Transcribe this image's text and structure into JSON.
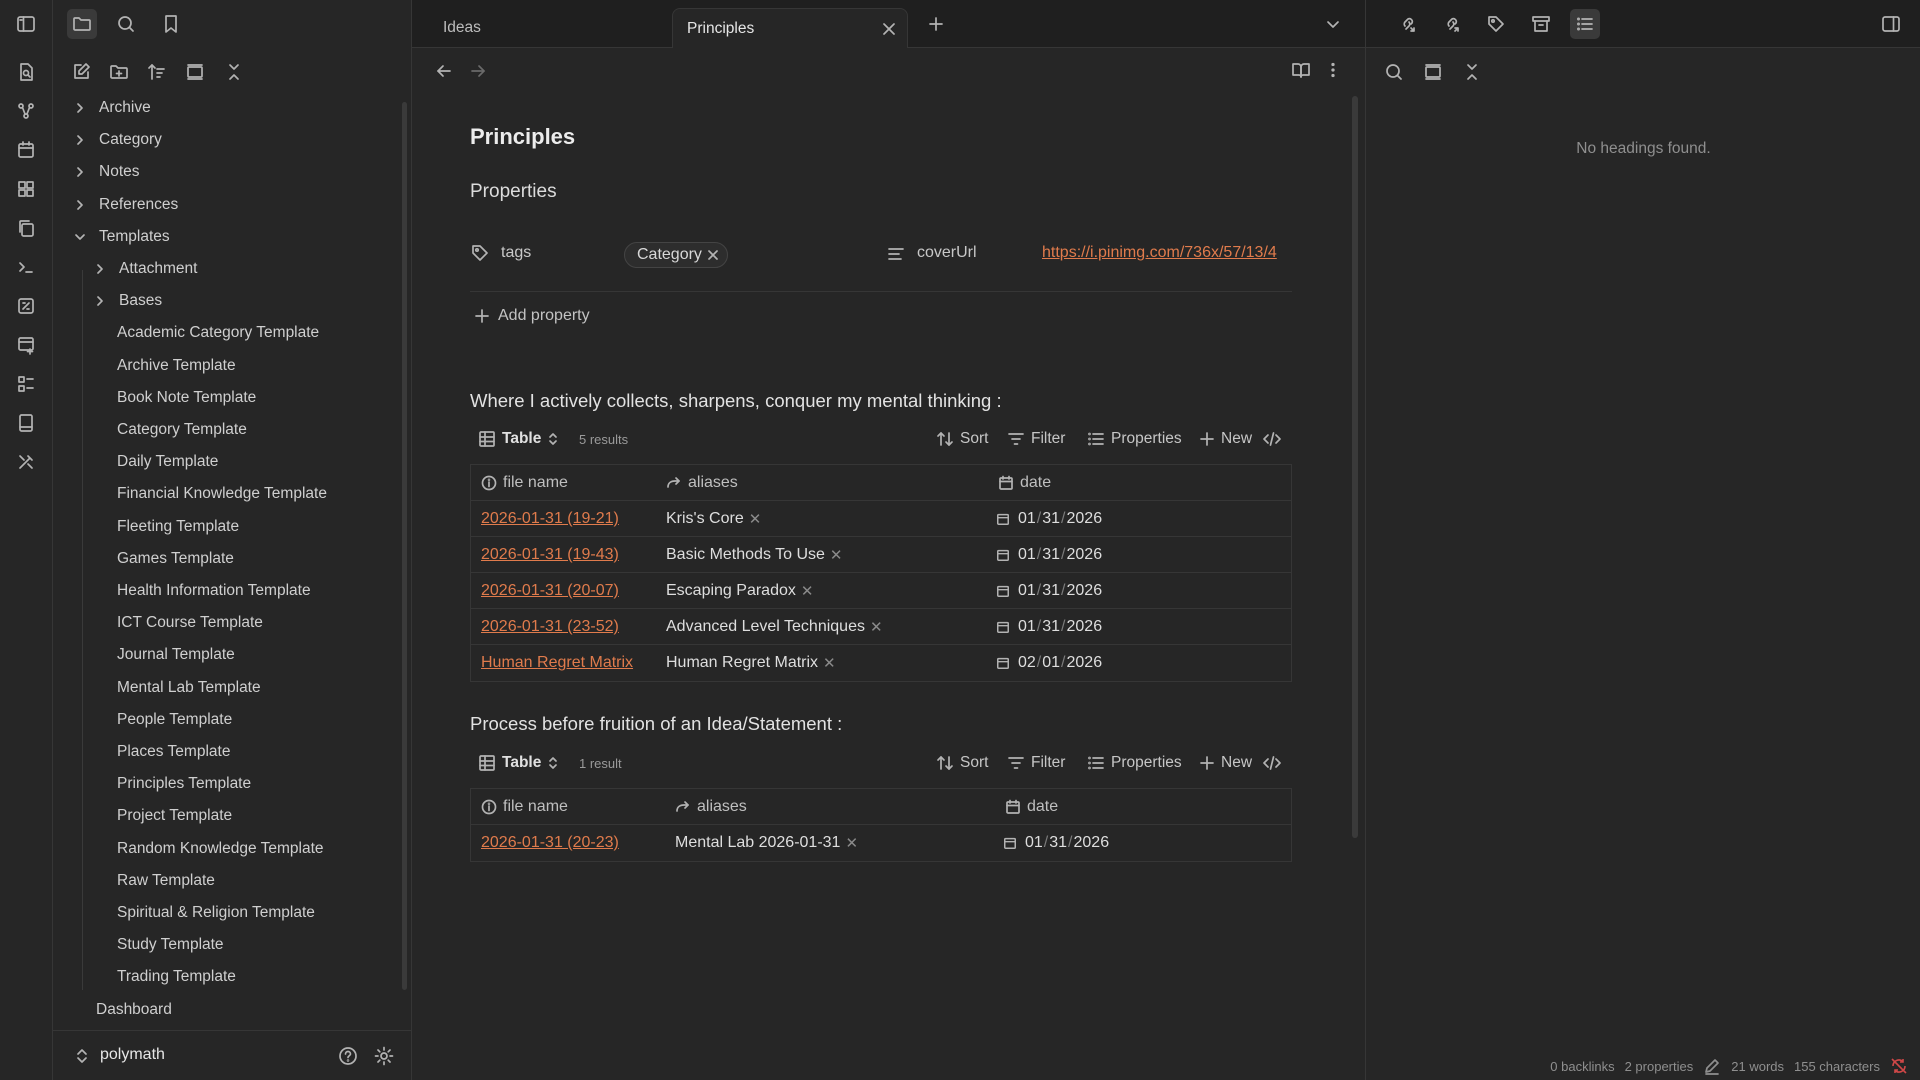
{
  "tabs": [
    {
      "label": "Ideas",
      "active": false
    },
    {
      "label": "Principles",
      "active": true
    }
  ],
  "sidebar": {
    "tree": [
      {
        "label": "Archive",
        "type": "folder",
        "expanded": false,
        "depth": 0
      },
      {
        "label": "Category",
        "type": "folder",
        "expanded": false,
        "depth": 0
      },
      {
        "label": "Notes",
        "type": "folder",
        "expanded": false,
        "depth": 0
      },
      {
        "label": "References",
        "type": "folder",
        "expanded": false,
        "depth": 0
      },
      {
        "label": "Templates",
        "type": "folder",
        "expanded": true,
        "depth": 0
      },
      {
        "label": "Attachment",
        "type": "folder",
        "expanded": false,
        "depth": 1
      },
      {
        "label": "Bases",
        "type": "folder",
        "expanded": false,
        "depth": 1
      },
      {
        "label": "Academic Category Template",
        "type": "file",
        "depth": 1
      },
      {
        "label": "Archive Template",
        "type": "file",
        "depth": 1
      },
      {
        "label": "Book Note Template",
        "type": "file",
        "depth": 1
      },
      {
        "label": "Category Template",
        "type": "file",
        "depth": 1
      },
      {
        "label": "Daily Template",
        "type": "file",
        "depth": 1
      },
      {
        "label": "Financial Knowledge Template",
        "type": "file",
        "depth": 1
      },
      {
        "label": "Fleeting Template",
        "type": "file",
        "depth": 1
      },
      {
        "label": "Games Template",
        "type": "file",
        "depth": 1
      },
      {
        "label": "Health Information Template",
        "type": "file",
        "depth": 1
      },
      {
        "label": "ICT Course Template",
        "type": "file",
        "depth": 1
      },
      {
        "label": "Journal Template",
        "type": "file",
        "depth": 1
      },
      {
        "label": "Mental Lab Template",
        "type": "file",
        "depth": 1
      },
      {
        "label": "People Template",
        "type": "file",
        "depth": 1
      },
      {
        "label": "Places Template",
        "type": "file",
        "depth": 1
      },
      {
        "label": "Principles Template",
        "type": "file",
        "depth": 1
      },
      {
        "label": "Project Template",
        "type": "file",
        "depth": 1
      },
      {
        "label": "Random Knowledge Template",
        "type": "file",
        "depth": 1
      },
      {
        "label": "Raw Template",
        "type": "file",
        "depth": 1
      },
      {
        "label": "Spiritual & Religion Template",
        "type": "file",
        "depth": 1
      },
      {
        "label": "Study Template",
        "type": "file",
        "depth": 1
      },
      {
        "label": "Trading Template",
        "type": "file",
        "depth": 1
      },
      {
        "label": "Dashboard",
        "type": "file",
        "depth": 0
      }
    ],
    "vault_name": "polymath"
  },
  "note": {
    "title": "Principles",
    "properties_heading": "Properties",
    "props": {
      "tags_key": "tags",
      "tags_value": "Category",
      "cover_key": "coverUrl",
      "cover_value": "https://i.pinimg.com/736x/57/13/4"
    },
    "add_property": "Add property"
  },
  "section1": {
    "heading": "Where I actively collects, sharpens, conquer my mental thinking :",
    "view": "Table",
    "count": "5 results",
    "toolbar": {
      "sort": "Sort",
      "filter": "Filter",
      "properties": "Properties",
      "new": "New"
    },
    "columns": {
      "file": "file name",
      "aliases": "aliases",
      "date": "date"
    },
    "rows": [
      {
        "file": "2026-01-31 (19-21)",
        "alias": "Kris's Core",
        "m": "01",
        "d": "31",
        "y": "2026"
      },
      {
        "file": "2026-01-31 (19-43)",
        "alias": "Basic Methods To Use",
        "m": "01",
        "d": "31",
        "y": "2026"
      },
      {
        "file": "2026-01-31 (20-07)",
        "alias": "Escaping Paradox",
        "m": "01",
        "d": "31",
        "y": "2026"
      },
      {
        "file": "2026-01-31 (23-52)",
        "alias": "Advanced Level Techniques",
        "m": "01",
        "d": "31",
        "y": "2026"
      },
      {
        "file": "Human Regret Matrix",
        "alias": "Human Regret Matrix",
        "m": "02",
        "d": "01",
        "y": "2026"
      }
    ]
  },
  "section2": {
    "heading": "Process before fruition of an Idea/Statement :",
    "view": "Table",
    "count": "1 result",
    "toolbar": {
      "sort": "Sort",
      "filter": "Filter",
      "properties": "Properties",
      "new": "New"
    },
    "columns": {
      "file": "file name",
      "aliases": "aliases",
      "date": "date"
    },
    "rows": [
      {
        "file": "2026-01-31 (20-23)",
        "alias": "Mental Lab 2026-01-31",
        "m": "01",
        "d": "31",
        "y": "2026"
      }
    ]
  },
  "outline": {
    "empty_text": "No headings found."
  },
  "status": {
    "backlinks": "0 backlinks",
    "properties": "2 properties",
    "words": "21 words",
    "characters": "155 characters"
  },
  "colors": {
    "accent_link": "#e07b4c",
    "background": "#262626",
    "tabbar": "#1f1f1f"
  }
}
